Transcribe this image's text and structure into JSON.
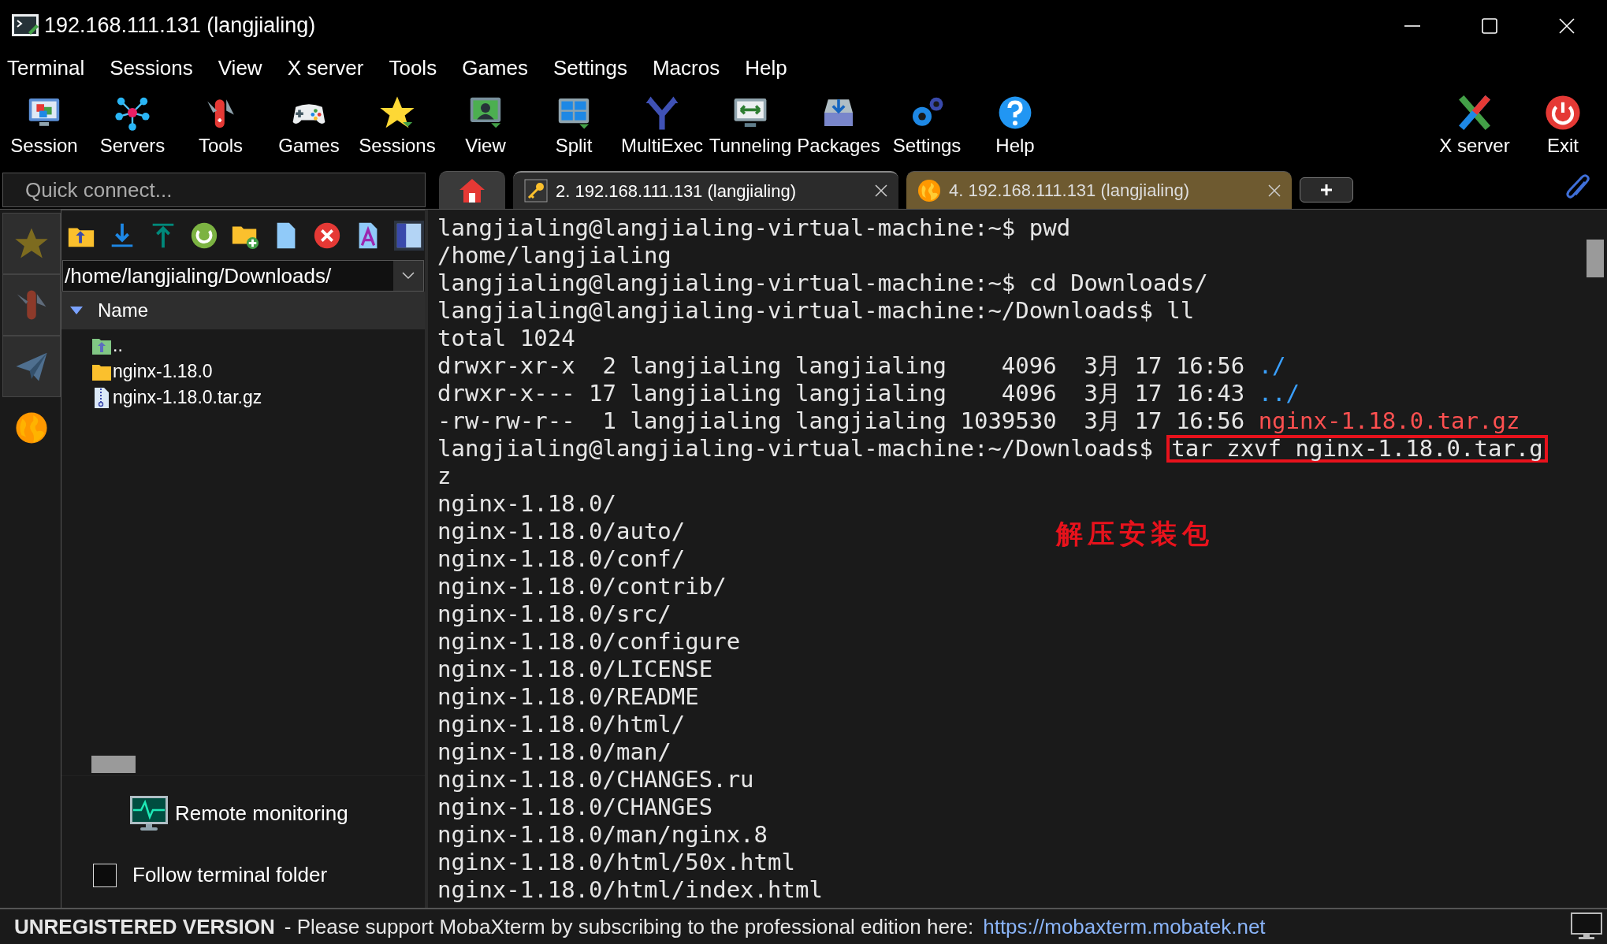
{
  "window": {
    "title": "192.168.111.131 (langjialing)"
  },
  "menu": [
    "Terminal",
    "Sessions",
    "View",
    "X server",
    "Tools",
    "Games",
    "Settings",
    "Macros",
    "Help"
  ],
  "toolbar": {
    "left": [
      "Session",
      "Servers",
      "Tools",
      "Games",
      "Sessions",
      "View",
      "Split",
      "MultiExec",
      "Tunneling",
      "Packages",
      "Settings",
      "Help"
    ],
    "right": [
      "X server",
      "Exit"
    ]
  },
  "quick_connect": {
    "placeholder": "Quick connect..."
  },
  "tabs": [
    {
      "kind": "home",
      "selected": false,
      "color": "#3a3a3a"
    },
    {
      "kind": "session",
      "label": "2. 192.168.111.131 (langjialing)",
      "selected": true,
      "color": "#2b2b2b"
    },
    {
      "kind": "session",
      "label": "4. 192.168.111.131 (langjialing)",
      "selected": false,
      "color": "#6e5a30"
    }
  ],
  "side_tabs": [
    {
      "selected": false
    },
    {
      "selected": false
    },
    {
      "selected": false
    },
    {
      "selected": true
    }
  ],
  "file_browser": {
    "path": "/home/langjialing/Downloads/",
    "column": "Name",
    "items": [
      {
        "kind": "parent",
        "name": ".."
      },
      {
        "kind": "folder",
        "name": "nginx-1.18.0"
      },
      {
        "kind": "archive",
        "name": "nginx-1.18.0.tar.gz"
      }
    ],
    "remote_monitoring": "Remote monitoring",
    "follow_folder": {
      "label": "Follow terminal folder",
      "checked": false
    }
  },
  "terminal": {
    "annotation": "解压安装包",
    "lines": [
      [
        {
          "kind": "text",
          "text": "langjialing@langjialing-virtual-machine:~$ pwd"
        }
      ],
      [
        {
          "kind": "text",
          "text": "/home/langjialing"
        }
      ],
      [
        {
          "kind": "text",
          "text": "langjialing@langjialing-virtual-machine:~$ cd Downloads/"
        }
      ],
      [
        {
          "kind": "text",
          "text": "langjialing@langjialing-virtual-machine:~/Downloads$ ll"
        }
      ],
      [
        {
          "kind": "text",
          "text": "total 1024"
        }
      ],
      [
        {
          "kind": "text",
          "text": "drwxr-xr-x  2 langjialing langjialing    4096  3月 17 16:56 "
        },
        {
          "kind": "dir",
          "text": "./"
        }
      ],
      [
        {
          "kind": "text",
          "text": "drwxr-x--- 17 langjialing langjialing    4096  3月 17 16:43 "
        },
        {
          "kind": "dir",
          "text": "../"
        }
      ],
      [
        {
          "kind": "text",
          "text": "-rw-rw-r--  1 langjialing langjialing 1039530  3月 17 16:56 "
        },
        {
          "kind": "archive",
          "text": "nginx-1.18.0.tar.gz"
        }
      ],
      [
        {
          "kind": "text",
          "text": "langjialing@langjialing-virtual-machine:~/Downloads$ "
        },
        {
          "kind": "boxed",
          "text": "tar zxvf nginx-1.18.0.tar.g"
        }
      ],
      [
        {
          "kind": "text",
          "text": "z"
        }
      ],
      [
        {
          "kind": "text",
          "text": "nginx-1.18.0/"
        }
      ],
      [
        {
          "kind": "text",
          "text": "nginx-1.18.0/auto/"
        }
      ],
      [
        {
          "kind": "text",
          "text": "nginx-1.18.0/conf/"
        }
      ],
      [
        {
          "kind": "text",
          "text": "nginx-1.18.0/contrib/"
        }
      ],
      [
        {
          "kind": "text",
          "text": "nginx-1.18.0/src/"
        }
      ],
      [
        {
          "kind": "text",
          "text": "nginx-1.18.0/configure"
        }
      ],
      [
        {
          "kind": "text",
          "text": "nginx-1.18.0/LICENSE"
        }
      ],
      [
        {
          "kind": "text",
          "text": "nginx-1.18.0/README"
        }
      ],
      [
        {
          "kind": "text",
          "text": "nginx-1.18.0/html/"
        }
      ],
      [
        {
          "kind": "text",
          "text": "nginx-1.18.0/man/"
        }
      ],
      [
        {
          "kind": "text",
          "text": "nginx-1.18.0/CHANGES.ru"
        }
      ],
      [
        {
          "kind": "text",
          "text": "nginx-1.18.0/CHANGES"
        }
      ],
      [
        {
          "kind": "text",
          "text": "nginx-1.18.0/man/nginx.8"
        }
      ],
      [
        {
          "kind": "text",
          "text": "nginx-1.18.0/html/50x.html"
        }
      ],
      [
        {
          "kind": "text",
          "text": "nginx-1.18.0/html/index.html"
        }
      ]
    ]
  },
  "status_bar": {
    "label": "UNREGISTERED VERSION",
    "message": "-  Please support MobaXterm by subscribing to the professional edition here:",
    "link": "https://mobaxterm.mobatek.net"
  }
}
